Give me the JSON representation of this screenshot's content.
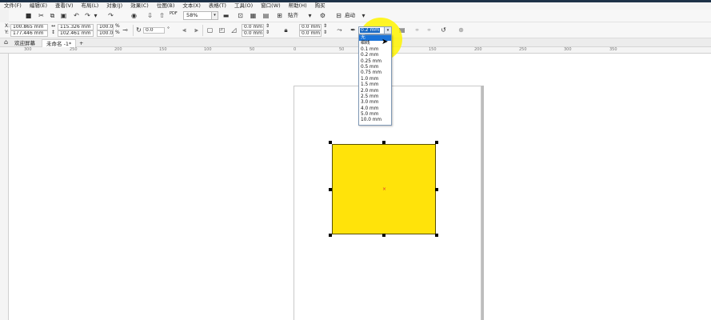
{
  "menu": [
    "文件(F)",
    "编辑(E)",
    "查看(V)",
    "布局(L)",
    "对象(J)",
    "效果(C)",
    "位图(B)",
    "文本(X)",
    "表格(T)",
    "工具(O)",
    "窗口(W)",
    "帮助(H)",
    "购买"
  ],
  "toolbar": {
    "pdf_label": "PDF",
    "zoom": "58%",
    "snap_label": "贴齐",
    "launch_label": "启动"
  },
  "props": {
    "x": "100.865 mm",
    "y": "177.446 mm",
    "width": "115.326 mm",
    "height": "102.461 mm",
    "scale_w": "100.0",
    "scale_h": "100.0",
    "pct": "%",
    "rotation": "0.0",
    "corner_1": "0.0 mm",
    "corner_2": "0.0 mm",
    "corner_3": "0.0 mm",
    "corner_4": "0.0 mm",
    "outline_width": "0.2 mm"
  },
  "outline_options": [
    "无",
    "细线",
    "0.1 mm",
    "0.2 mm",
    "0.25 mm",
    "0.5 mm",
    "0.75 mm",
    "1.0 mm",
    "1.5 mm",
    "2.0 mm",
    "2.5 mm",
    "3.0 mm",
    "4.0 mm",
    "5.0 mm",
    "10.0 mm"
  ],
  "tabs": {
    "welcome": "欢迎屏幕",
    "doc": "未命名 -1*",
    "add": "+"
  },
  "ruler": [
    "300",
    "250",
    "200",
    "150",
    "100",
    "50",
    "0",
    "50",
    "100",
    "150",
    "200",
    "250",
    "300",
    "350"
  ],
  "colors": {
    "fill": "#ffe30a",
    "highlight": "#fff400",
    "selected": "#1a73d8"
  }
}
